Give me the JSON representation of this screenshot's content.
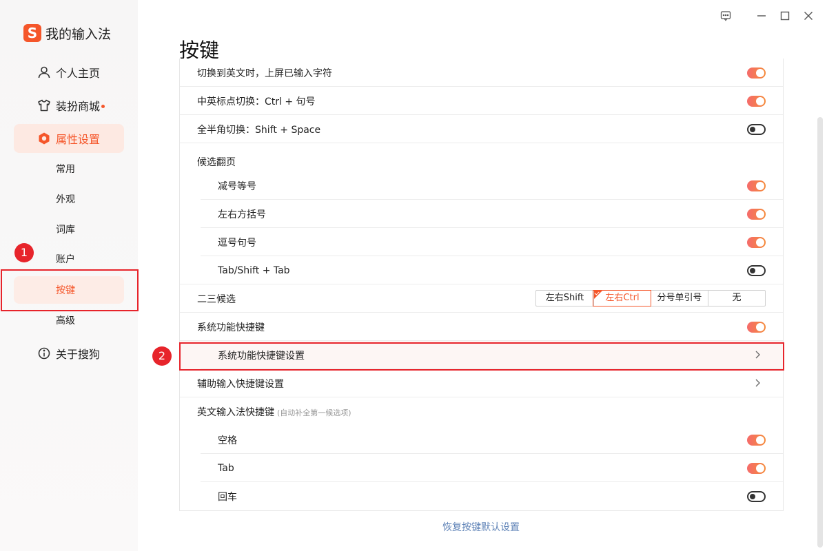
{
  "app": {
    "name": "我的输入法"
  },
  "sidebar": {
    "nav": [
      {
        "label": "个人主页",
        "icon": "user-icon"
      },
      {
        "label": "装扮商城",
        "icon": "shirt-icon",
        "badge_dot": true
      },
      {
        "label": "属性设置",
        "icon": "settings-hex-icon",
        "active": true
      },
      {
        "label": "关于搜狗",
        "icon": "info-icon"
      }
    ],
    "sub": [
      {
        "label": "常用"
      },
      {
        "label": "外观"
      },
      {
        "label": "词库"
      },
      {
        "label": "账户"
      },
      {
        "label": "按键",
        "active": true
      },
      {
        "label": "高级"
      }
    ]
  },
  "markers": [
    "1",
    "2"
  ],
  "page": {
    "title": "按键"
  },
  "settings": {
    "switch_english": {
      "label": "切换到英文时，上屏已输入字符",
      "on": true
    },
    "punct_switch": {
      "label": "中英标点切换：Ctrl + 句号",
      "on": true
    },
    "width_switch": {
      "label": "全半角切换：Shift + Space",
      "on": false
    },
    "candidate_page": {
      "label": "候选翻页",
      "items": [
        {
          "label": "减号等号",
          "on": true
        },
        {
          "label": "左右方括号",
          "on": true
        },
        {
          "label": "逗号句号",
          "on": true
        },
        {
          "label": "Tab/Shift + Tab",
          "on": false
        }
      ]
    },
    "second_third": {
      "label": "二三候选",
      "options": [
        "左右Shift",
        "左右Ctrl",
        "分号单引号",
        "无"
      ],
      "selected": "左右Ctrl"
    },
    "sys_shortcut": {
      "label": "系统功能快捷键",
      "on": true
    },
    "sys_shortcut_settings": {
      "label": "系统功能快捷键设置"
    },
    "aux_shortcut_settings": {
      "label": "辅助输入快捷键设置"
    },
    "english_ime": {
      "label": "英文输入法快捷键",
      "hint": "(自动补全第一候选项)",
      "items": [
        {
          "label": "空格",
          "on": true
        },
        {
          "label": "Tab",
          "on": true
        },
        {
          "label": "回车",
          "on": false
        }
      ]
    }
  },
  "footer": {
    "reset_label": "恢复按键默认设置"
  },
  "colors": {
    "accent": "#f5562a",
    "marker": "#e7242b",
    "link": "#5f83b7"
  }
}
